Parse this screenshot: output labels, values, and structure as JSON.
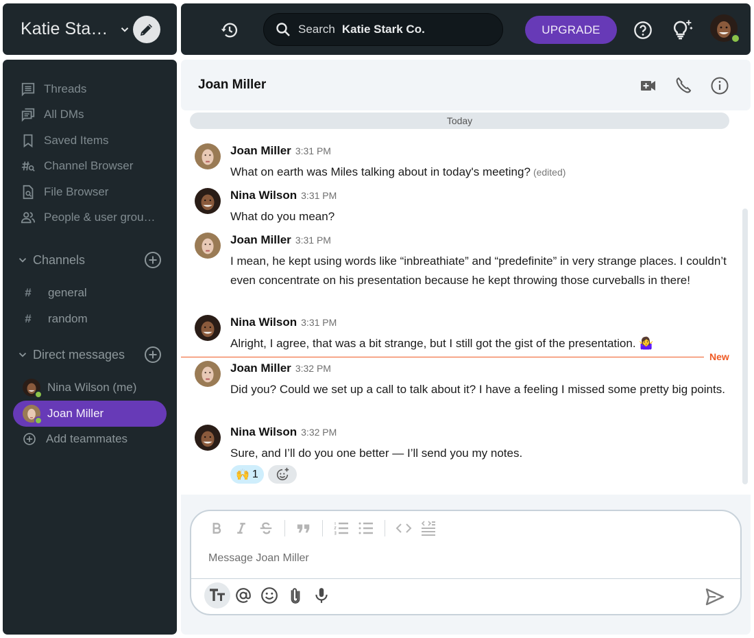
{
  "workspace": {
    "name": "Katie Sta…",
    "compose_label": "New message"
  },
  "topbar": {
    "search_label": "Search",
    "search_scope": "Katie Stark Co.",
    "upgrade_label": "UPGRADE",
    "status_color": "#8bc34a"
  },
  "sidebar": {
    "nav": [
      {
        "label": "Threads",
        "icon": "threads-icon"
      },
      {
        "label": "All DMs",
        "icon": "all-dms-icon"
      },
      {
        "label": "Saved Items",
        "icon": "bookmark-icon"
      },
      {
        "label": "Channel Browser",
        "icon": "channel-browser-icon"
      },
      {
        "label": "File Browser",
        "icon": "file-browser-icon"
      },
      {
        "label": "People & user grou…",
        "icon": "people-icon"
      }
    ],
    "channels_label": "Channels",
    "channels": [
      {
        "name": "general"
      },
      {
        "name": "random"
      }
    ],
    "dms_label": "Direct messages",
    "dms": [
      {
        "name": "Nina Wilson (me)",
        "active": false
      },
      {
        "name": "Joan Miller",
        "active": true
      }
    ],
    "add_teammates_label": "Add teammates"
  },
  "chat": {
    "title": "Joan Miller",
    "day_label": "Today",
    "new_label": "New",
    "messages": [
      {
        "author": "Joan Miller",
        "time": "3:31 PM",
        "text": "What on earth was Miles talking about in today's meeting?",
        "edited": "(edited)"
      },
      {
        "author": "Nina Wilson",
        "time": "3:31 PM",
        "text": "What do you mean?"
      },
      {
        "author": "Joan Miller",
        "time": "3:31 PM",
        "text": "I mean, he kept using words like “inbreathiate” and “predefinite” in very strange places. I couldn’t even concentrate on his presentation because he kept throwing those curveballs in there!"
      },
      {
        "author": "Nina Wilson",
        "time": "3:31 PM",
        "text": "Alright, I agree, that was a bit strange, but I still got the gist of the presentation. 🤷‍♀️"
      },
      {
        "author": "Joan Miller",
        "time": "3:32 PM",
        "text": "Did you? Could we set up a call to talk about it? I have a feeling I missed some pretty big points."
      },
      {
        "author": "Nina Wilson",
        "time": "3:32 PM",
        "text": "Sure, and I’ll do you one better — I’ll send you my notes."
      }
    ],
    "reaction": {
      "emoji": "🙌",
      "count": "1"
    }
  },
  "composer": {
    "placeholder": "Message Joan Miller"
  },
  "colors": {
    "accent": "#673ab7",
    "sidebar_bg": "#1e272c",
    "new_marker": "#ef5a24",
    "online": "#8bc34a"
  }
}
